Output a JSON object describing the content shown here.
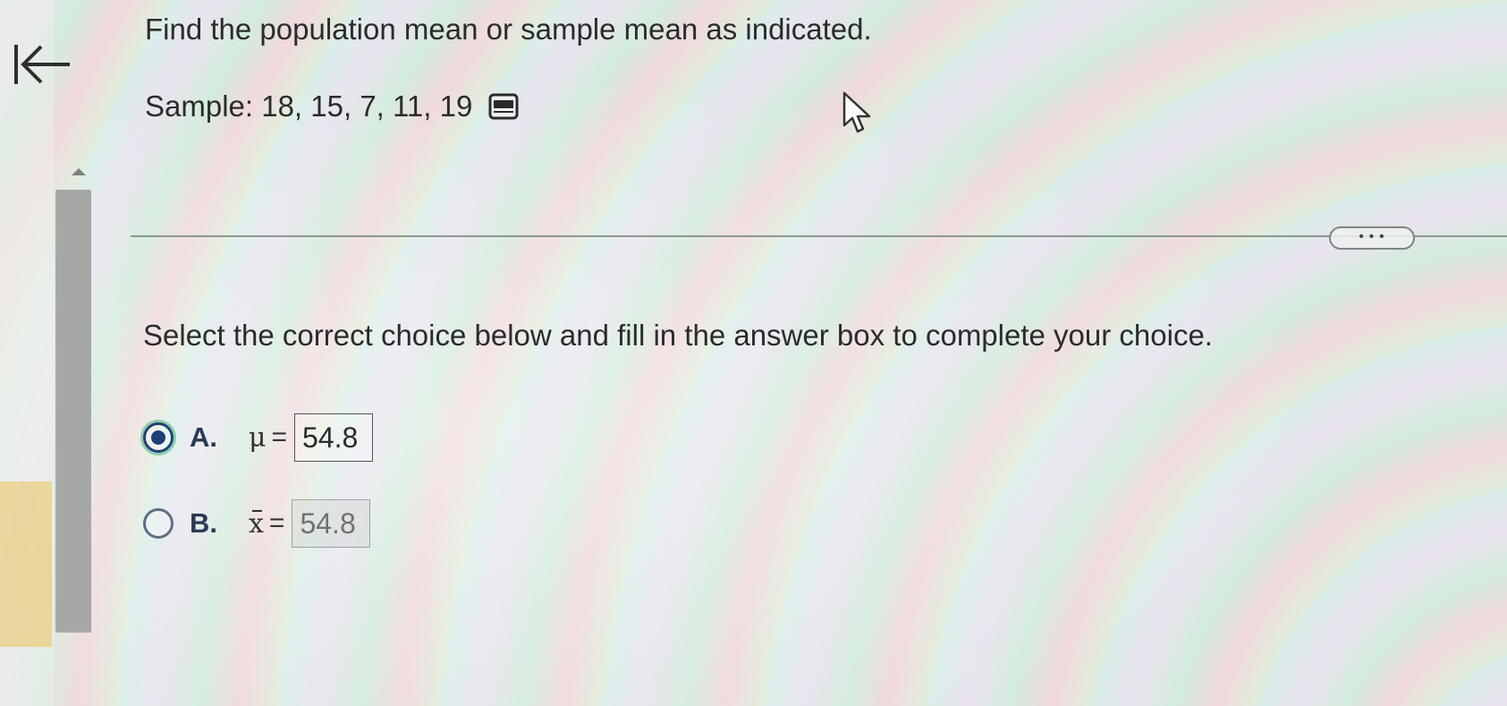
{
  "question": {
    "title": "Find the population mean or sample mean as indicated.",
    "sample_text": "Sample: 18, 15, 7, 11, 19",
    "instruction": "Select the correct choice below and fill in the answer box to complete your choice."
  },
  "more_button": {
    "label": "• • •"
  },
  "choices": [
    {
      "letter": "A.",
      "symbol": "μ",
      "equals": "=",
      "answer": "54.8",
      "selected": true
    },
    {
      "letter": "B.",
      "symbol": "x",
      "equals": "=",
      "answer": "54.8",
      "selected": false
    }
  ],
  "icons": {
    "back": "back-to-start-icon",
    "data": "data-table-icon",
    "cursor": "mouse-pointer-icon",
    "scroll_up": "scroll-up-arrow-icon"
  },
  "colors": {
    "text": "#2b2b2b",
    "radio_selected": "#1f3f7a",
    "scrollbar": "#a6a8a6"
  }
}
